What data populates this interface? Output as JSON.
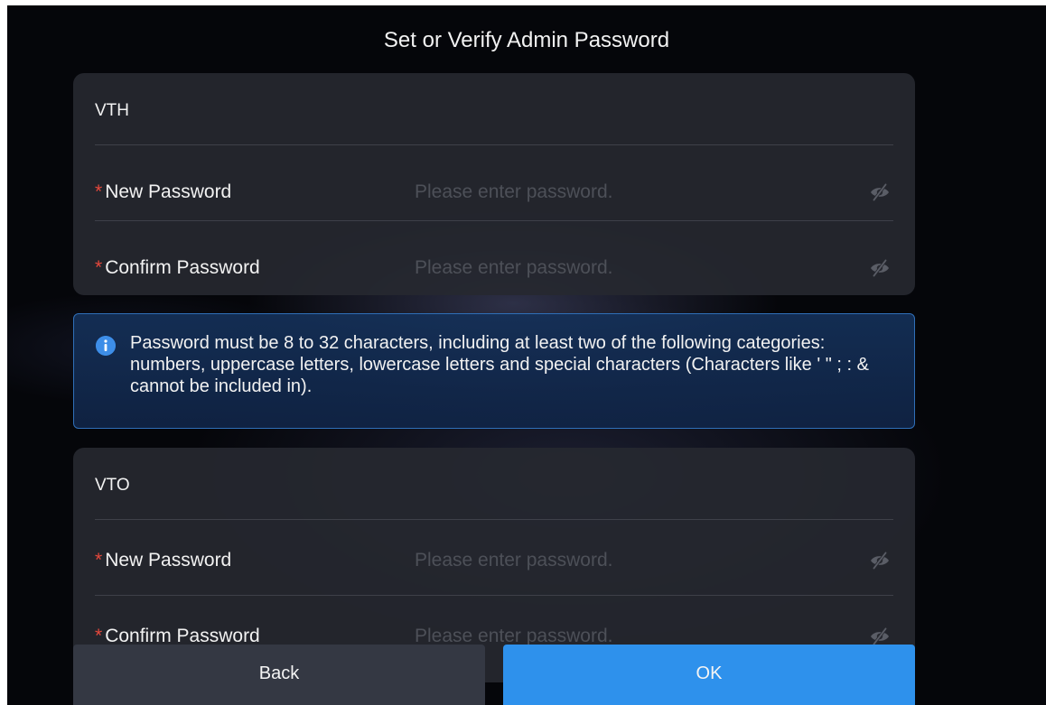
{
  "page": {
    "title": "Set or Verify Admin Password"
  },
  "vth": {
    "header": "VTH",
    "new_password": {
      "required_mark": "*",
      "label": "New Password",
      "placeholder": "Please enter password.",
      "value": "",
      "toggle_icon": "eye-off-icon"
    },
    "confirm_password": {
      "required_mark": "*",
      "label": "Confirm Password",
      "placeholder": "Please enter password.",
      "value": "",
      "toggle_icon": "eye-off-icon"
    }
  },
  "notice": {
    "icon": "info-icon",
    "text": "Password must be 8 to 32 characters, including at least two of the following categories: numbers, uppercase letters, lowercase letters and special characters (Characters like ' \" ; : & cannot be included in)."
  },
  "vto": {
    "header": "VTO",
    "new_password": {
      "required_mark": "*",
      "label": "New Password",
      "placeholder": "Please enter password.",
      "value": "",
      "toggle_icon": "eye-off-icon"
    },
    "confirm_password": {
      "required_mark": "*",
      "label": "Confirm Password",
      "placeholder": "Please enter password.",
      "value": "",
      "toggle_icon": "eye-off-icon"
    }
  },
  "buttons": {
    "back": "Back",
    "ok": "OK"
  },
  "colors": {
    "background": "#05060a",
    "card": "#26282f",
    "accent": "#2e91ec",
    "required": "#e5483c",
    "notice_border": "#2f6fb8"
  }
}
